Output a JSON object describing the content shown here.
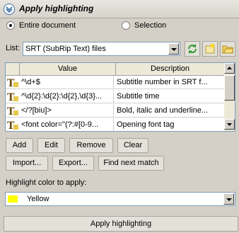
{
  "panel": {
    "title": "Apply highlighting"
  },
  "scope": {
    "entire_document": "Entire document",
    "selection": "Selection"
  },
  "list": {
    "label": "List:",
    "selected": "SRT (SubRip Text) files"
  },
  "grid": {
    "headers": [
      "Value",
      "Description"
    ],
    "rows": [
      {
        "value": "^\\d+$",
        "description": "Subtitle number in SRT f..."
      },
      {
        "value": "^\\d{2}:\\d{2}:\\d{2},\\d{3}...",
        "description": "Subtitle time"
      },
      {
        "value": "</?[biu]>",
        "description": "Bold, italic and underline..."
      },
      {
        "value": "<font color=\"(?:#[0-9...",
        "description": "Opening font tag"
      }
    ]
  },
  "buttons": {
    "add": "Add",
    "edit": "Edit",
    "remove": "Remove",
    "clear": "Clear",
    "import": "Import...",
    "export": "Export...",
    "find_next": "Find next match",
    "apply": "Apply highlighting"
  },
  "highlight": {
    "label": "Highlight color to apply:",
    "color_name": "Yellow",
    "color": "#ffff00"
  },
  "icons": {
    "refresh": "refresh-icon",
    "new_list": "new-list-icon",
    "open_folder": "open-folder-icon",
    "row": "regex-text-icon"
  }
}
